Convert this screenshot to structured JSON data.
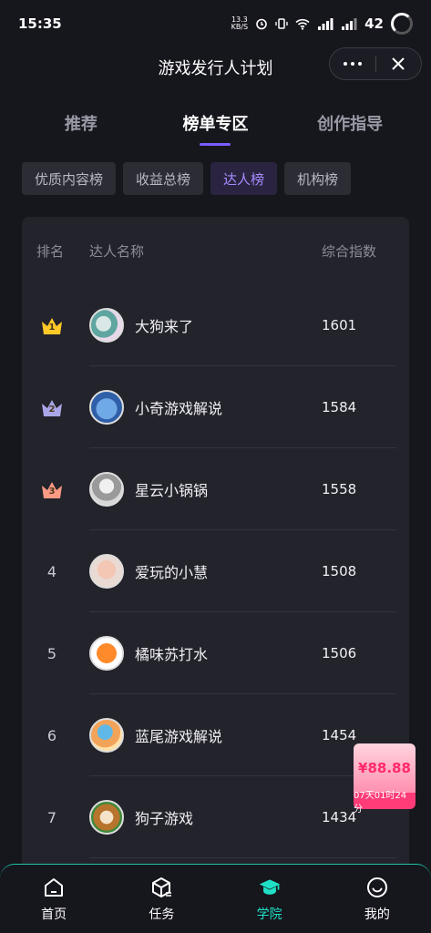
{
  "status_bar": {
    "time": "15:35",
    "net_speed_top": "13.3",
    "net_speed_bottom": "KB/S",
    "battery": "42"
  },
  "nav": {
    "title": "游戏发行人计划",
    "more_icon": "more-dots-icon",
    "close_icon": "close-icon"
  },
  "tabs": [
    {
      "label": "推荐",
      "active": false
    },
    {
      "label": "榜单专区",
      "active": true
    },
    {
      "label": "创作指导",
      "active": false
    }
  ],
  "chips": [
    {
      "label": "优质内容榜",
      "active": false
    },
    {
      "label": "收益总榜",
      "active": false
    },
    {
      "label": "达人榜",
      "active": true
    },
    {
      "label": "机构榜",
      "active": false
    }
  ],
  "table": {
    "headers": {
      "rank": "排名",
      "name": "达人名称",
      "score": "综合指数"
    },
    "rows": [
      {
        "rank": "1",
        "name": "大狗来了",
        "score": "1601",
        "crown": "gold"
      },
      {
        "rank": "2",
        "name": "小奇游戏解说",
        "score": "1584",
        "crown": "silver"
      },
      {
        "rank": "3",
        "name": "星云小锅锅",
        "score": "1558",
        "crown": "bronze"
      },
      {
        "rank": "4",
        "name": "爱玩的小慧",
        "score": "1508"
      },
      {
        "rank": "5",
        "name": "橘味苏打水",
        "score": "1506"
      },
      {
        "rank": "6",
        "name": "蓝尾游戏解说",
        "score": "1454"
      },
      {
        "rank": "7",
        "name": "狗子游戏",
        "score": "1434"
      }
    ]
  },
  "promo": {
    "price": "¥88.88",
    "timer": "07天01时24分"
  },
  "bottom_nav": [
    {
      "label": "首页",
      "icon": "home-icon",
      "active": false
    },
    {
      "label": "任务",
      "icon": "task-cube-icon",
      "active": false
    },
    {
      "label": "学院",
      "icon": "graduation-cap-icon",
      "active": true
    },
    {
      "label": "我的",
      "icon": "smile-profile-icon",
      "active": false
    }
  ],
  "colors": {
    "accent": "#7a5cff",
    "teal": "#1fe0c6",
    "gold": "#ffc928",
    "silver": "#a9a6e8",
    "bronze": "#ff9a84"
  }
}
